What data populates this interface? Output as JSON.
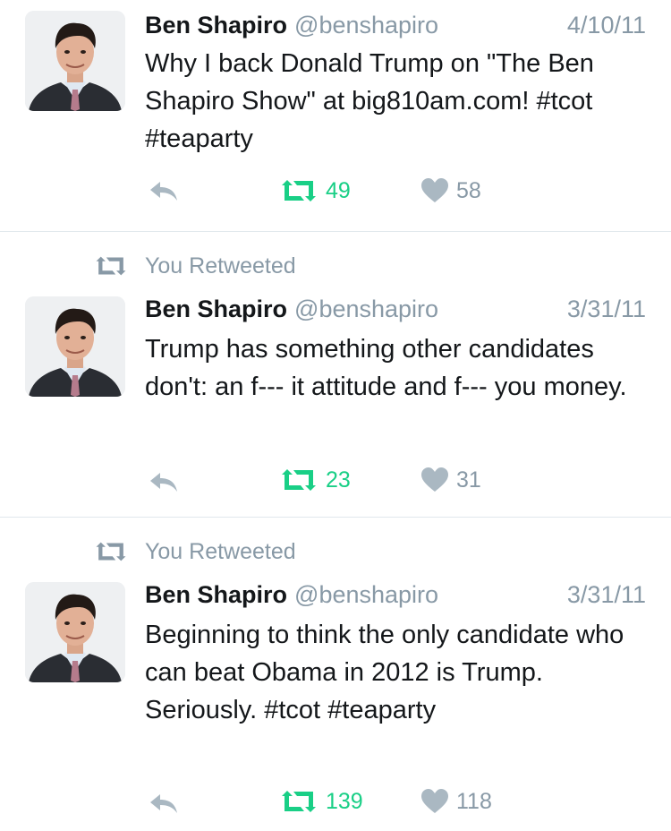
{
  "colors": {
    "retweet_green": "#19cf86",
    "muted_gray": "#8899a6",
    "text_dark": "#14171a",
    "divider": "#e1e8ed"
  },
  "icons": {
    "reply": "reply-arrow-icon",
    "retweet": "retweet-icon",
    "like": "heart-icon"
  },
  "tweets": [
    {
      "retweet_banner": "",
      "name": "Ben Shapiro",
      "handle": "@benshapiro",
      "date": "4/10/11",
      "text": "Why I back Donald Trump on \"The Ben Shapiro Show\" at big810am.com! #tcot #teaparty",
      "retweets": "49",
      "likes": "58"
    },
    {
      "retweet_banner": "You Retweeted",
      "name": "Ben Shapiro",
      "handle": "@benshapiro",
      "date": "3/31/11",
      "text": "Trump has something other candidates don't: an f--- it attitude and f--- you money.",
      "retweets": "23",
      "likes": "31"
    },
    {
      "retweet_banner": "You Retweeted",
      "name": "Ben Shapiro",
      "handle": "@benshapiro",
      "date": "3/31/11",
      "text": "Beginning to think the only candidate who can beat Obama in 2012 is Trump. Seriously. #tcot #teaparty",
      "retweets": "139",
      "likes": "118"
    }
  ]
}
